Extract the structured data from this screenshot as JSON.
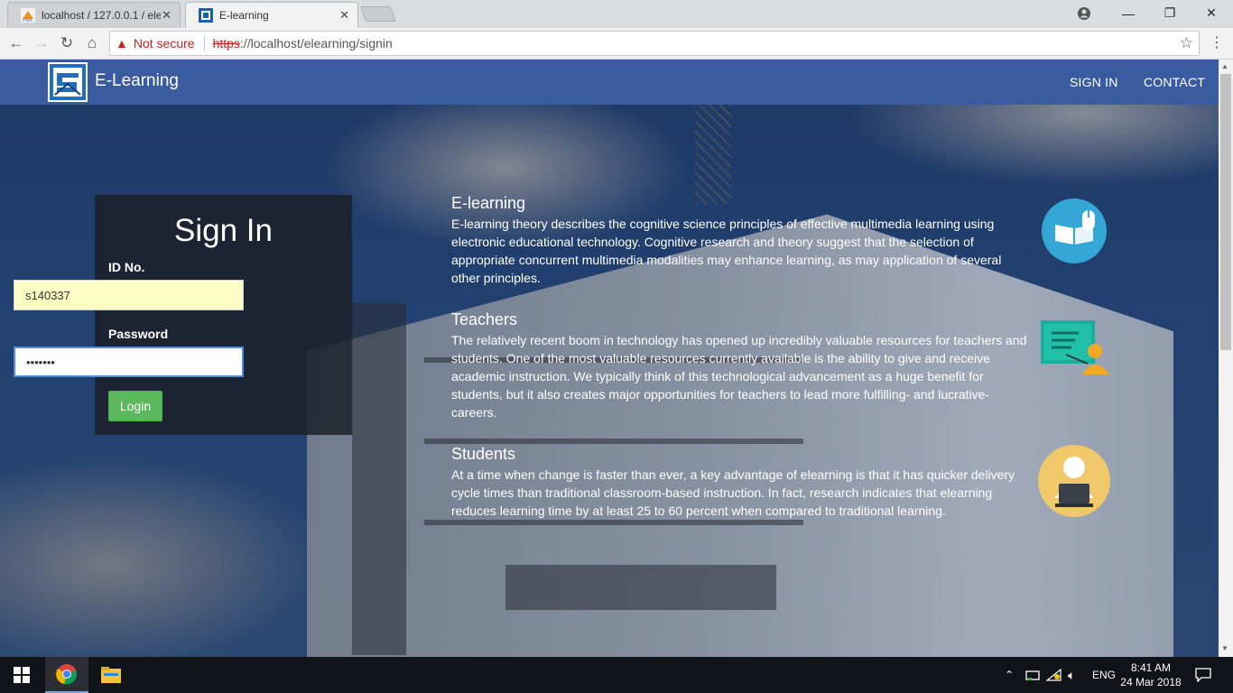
{
  "browser": {
    "tabs": [
      {
        "label": "localhost / 127.0.0.1 / ele",
        "active": false,
        "icon": "phpmyadmin-icon"
      },
      {
        "label": "E-learning",
        "active": true,
        "icon": "elearning-favicon"
      }
    ],
    "security_label": "Not secure",
    "url_scheme": "https",
    "url_rest": "://localhost/elearning/signin"
  },
  "navbar": {
    "brand": "E-Learning",
    "links": [
      "SIGN IN",
      "CONTACT"
    ]
  },
  "signin": {
    "title": "Sign In",
    "id_label": "ID No.",
    "id_value": "s140337",
    "password_label": "Password",
    "password_value": "•••••••",
    "login_label": "Login"
  },
  "sections": [
    {
      "title": "E-learning",
      "text": "E-learning theory describes the cognitive science principles of effective multimedia learning using electronic educational technology. Cognitive research and theory suggest that the selection of appropriate concurrent multimedia modalities may enhance learning, as may application of several other principles.",
      "icon": "book-mouse-icon"
    },
    {
      "title": "Teachers",
      "text": "The relatively recent boom in technology has opened up incredibly valuable resources for teachers and students. One of the most valuable resources currently available is the ability to give and receive academic instruction. We typically think of this technological advancement as a huge benefit for students, but it also creates major opportunities for teachers to lead more fulfilling- and lucrative- careers.",
      "icon": "teacher-board-icon"
    },
    {
      "title": "Students",
      "text": "At a time when change is faster than ever, a key advantage of elearning is that it has quicker delivery cycle times than traditional classroom-based instruction. In fact, research indicates that elearning reduces learning time by at least 25 to 60 percent when compared to traditional learning.",
      "icon": "student-laptop-icon"
    }
  ],
  "taskbar": {
    "language": "ENG",
    "time": "8:41 AM",
    "date": "24 Mar 2018"
  },
  "colors": {
    "navbar": "#3b5ba0",
    "login_button": "#5cb85c",
    "warning": "#c5221f"
  }
}
